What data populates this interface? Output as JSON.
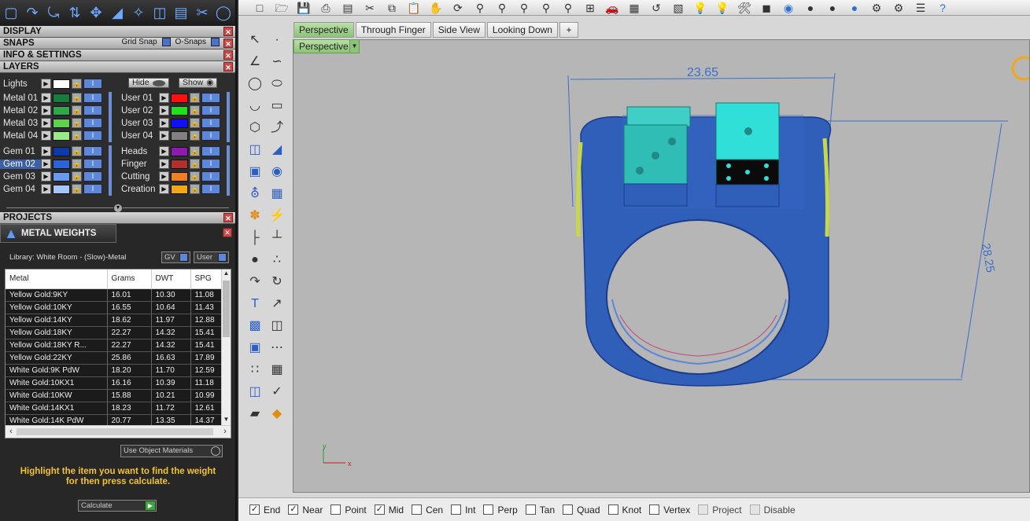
{
  "left_panel": {
    "toolbar_icons": [
      "cube-icon",
      "curve-icon",
      "rotate-icon",
      "move-icon",
      "arrow-icon",
      "gem-icon",
      "mirror-icon",
      "weight-icon",
      "scale-icon",
      "ring-icon",
      "circle-icon"
    ],
    "sections": {
      "display": "DISPLAY",
      "snaps": "SNAPS",
      "grid_snap": "Grid Snap",
      "osnaps": "O-Snaps",
      "info": "INFO & SETTINGS",
      "layers": "LAYERS",
      "projects": "PROJECTS"
    },
    "layers_left": [
      {
        "name": "Lights",
        "color": "#ffffff"
      },
      {
        "name": "Metal 01",
        "color": "#1b7a3e"
      },
      {
        "name": "Metal 02",
        "color": "#2fa84c"
      },
      {
        "name": "Metal 03",
        "color": "#5fd04f"
      },
      {
        "name": "Metal 04",
        "color": "#9ae88a"
      },
      {
        "name": "Gem 01",
        "color": "#0d3aa8"
      },
      {
        "name": "Gem 02",
        "color": "#2c63d6",
        "selected": true
      },
      {
        "name": "Gem 03",
        "color": "#6a9af0"
      },
      {
        "name": "Gem 04",
        "color": "#a6c6f8"
      }
    ],
    "layers_right": [
      {
        "name": "User 01",
        "color": "#ff1010"
      },
      {
        "name": "User 02",
        "color": "#20e020"
      },
      {
        "name": "User 03",
        "color": "#1010ff"
      },
      {
        "name": "User 04",
        "color": "#808080"
      },
      {
        "name": "Heads",
        "color": "#8e1ab0"
      },
      {
        "name": "Finger",
        "color": "#b03030"
      },
      {
        "name": "Cutting",
        "color": "#f08020"
      },
      {
        "name": "Creation",
        "color": "#f0a818"
      }
    ],
    "hide_label": "Hide",
    "show_label": "Show"
  },
  "metal_weights": {
    "title": "METAL WEIGHTS",
    "library": "Library: White Room - (Slow)-Metal",
    "gv_label": "GV",
    "user_label": "User",
    "columns": [
      "Metal",
      "Grams",
      "DWT",
      "SPG"
    ],
    "rows": [
      [
        "Yellow Gold:9KY",
        "16.01",
        "10.30",
        "11.08"
      ],
      [
        "Yellow Gold:10KY",
        "16.55",
        "10.64",
        "11.43"
      ],
      [
        "Yellow Gold:14KY",
        "18.62",
        "11.97",
        "12.88"
      ],
      [
        "Yellow Gold:18KY",
        "22.27",
        "14.32",
        "15.41"
      ],
      [
        "Yellow Gold:18KY R...",
        "22.27",
        "14.32",
        "15.41"
      ],
      [
        "Yellow Gold:22KY",
        "25.86",
        "16.63",
        "17.89"
      ],
      [
        "White Gold:9K PdW",
        "18.20",
        "11.70",
        "12.59"
      ],
      [
        "White Gold:10KX1",
        "16.16",
        "10.39",
        "11.18"
      ],
      [
        "White Gold:10KW",
        "15.88",
        "10.21",
        "10.99"
      ],
      [
        "White Gold:14KX1",
        "18.23",
        "11.72",
        "12.61"
      ],
      [
        "White Gold:14K PdW",
        "20.77",
        "13.35",
        "14.37"
      ]
    ],
    "use_object_materials": "Use Object Materials",
    "instruction_line1": "Highlight the item you want to find the weight",
    "instruction_line2": "for then press calculate.",
    "calculate": "Calculate"
  },
  "viewport_tabs": [
    "Perspective",
    "Through Finger",
    "Side View",
    "Looking Down"
  ],
  "active_viewport": "Perspective",
  "dimensions": {
    "width_label": "23.65",
    "height_label": "28.25"
  },
  "axis": {
    "x": "x",
    "y": "y"
  },
  "osnaps": [
    {
      "label": "End",
      "checked": true
    },
    {
      "label": "Near",
      "checked": true
    },
    {
      "label": "Point",
      "checked": false
    },
    {
      "label": "Mid",
      "checked": true
    },
    {
      "label": "Cen",
      "checked": false
    },
    {
      "label": "Int",
      "checked": false
    },
    {
      "label": "Perp",
      "checked": false
    },
    {
      "label": "Tan",
      "checked": false
    },
    {
      "label": "Quad",
      "checked": false
    },
    {
      "label": "Knot",
      "checked": false
    },
    {
      "label": "Vertex",
      "checked": false
    },
    {
      "label": "Project",
      "checked": false,
      "disabled": true
    },
    {
      "label": "Disable",
      "checked": false,
      "disabled": true
    }
  ],
  "colors": {
    "ring": "#2f5fb8",
    "dice": "#2fd6d0",
    "dim": "#3b6fc8",
    "accent_yellow": "#f3c32a"
  }
}
